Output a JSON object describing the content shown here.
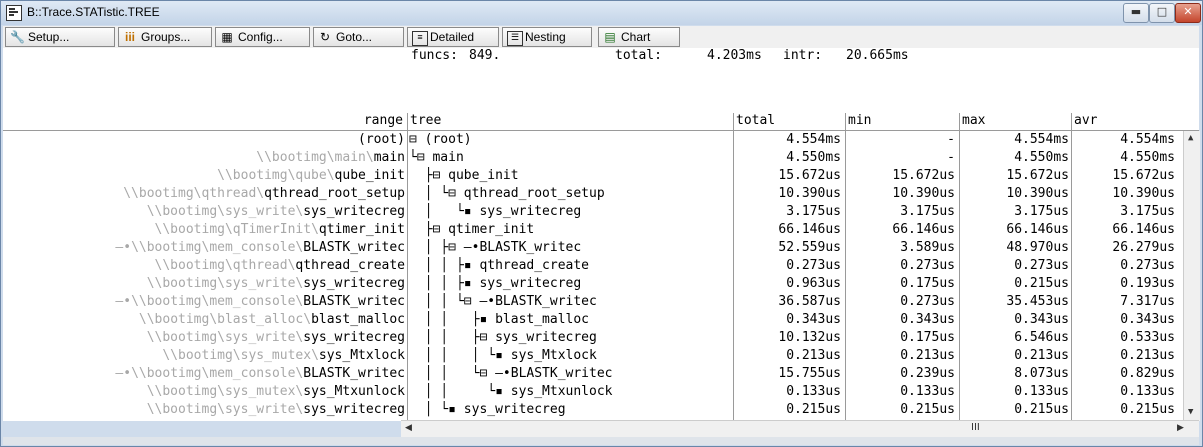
{
  "window": {
    "title": "B::Trace.STATistic.TREE",
    "min_label": "▬",
    "max_label": "□",
    "close_label": "✕"
  },
  "toolbar": {
    "setup": "Setup...",
    "groups": "Groups...",
    "config": "Config...",
    "goto": "Goto...",
    "detailed": "Detailed",
    "nesting": "Nesting",
    "chart": "Chart"
  },
  "stats": {
    "funcs_label": "funcs:",
    "funcs_value": "849.",
    "total_label": "total:",
    "total_value": "4.203ms",
    "intr_label": "intr:",
    "intr_value": "20.665ms"
  },
  "headers": {
    "range": "range",
    "tree": "tree",
    "total": "total",
    "min": "min",
    "max": "max",
    "avr": "avr"
  },
  "rows": [
    {
      "prefix": "",
      "path": "",
      "name": "(root)",
      "tree": "⊟ (root)",
      "total": "4.554ms",
      "min": "-",
      "max": "4.554ms",
      "avr": "4.554ms"
    },
    {
      "prefix": "",
      "path": "\\\\bootimg\\main\\",
      "name": "main",
      "tree": "└⊟ main",
      "total": "4.550ms",
      "min": "-",
      "max": "4.550ms",
      "avr": "4.550ms"
    },
    {
      "prefix": "",
      "path": "\\\\bootimg\\qube\\",
      "name": "qube_init",
      "tree": "  ├⊟ qube_init",
      "total": "15.672us",
      "min": "15.672us",
      "max": "15.672us",
      "avr": "15.672us"
    },
    {
      "prefix": "",
      "path": "\\\\bootimg\\qthread\\",
      "name": "qthread_root_setup",
      "tree": "  │ └⊟ qthread_root_setup",
      "total": "10.390us",
      "min": "10.390us",
      "max": "10.390us",
      "avr": "10.390us"
    },
    {
      "prefix": "",
      "path": "\\\\bootimg\\sys_write\\",
      "name": "sys_writecreg",
      "tree": "  │   └▪ sys_writecreg",
      "total": "3.175us",
      "min": "3.175us",
      "max": "3.175us",
      "avr": "3.175us"
    },
    {
      "prefix": "",
      "path": "\\\\bootimg\\qTimerInit\\",
      "name": "qtimer_init",
      "tree": "  ├⊟ qtimer_init",
      "total": "66.146us",
      "min": "66.146us",
      "max": "66.146us",
      "avr": "66.146us"
    },
    {
      "prefix": "—•",
      "path": "\\\\bootimg\\mem_console\\",
      "name": "BLASTK_writec",
      "tree": "  │ ├⊟ —•BLASTK_writec",
      "total": "52.559us",
      "min": "3.589us",
      "max": "48.970us",
      "avr": "26.279us"
    },
    {
      "prefix": "",
      "path": "\\\\bootimg\\qthread\\",
      "name": "qthread_create",
      "tree": "  │ │ ├▪ qthread_create",
      "total": "0.273us",
      "min": "0.273us",
      "max": "0.273us",
      "avr": "0.273us"
    },
    {
      "prefix": "",
      "path": "\\\\bootimg\\sys_write\\",
      "name": "sys_writecreg",
      "tree": "  │ │ ├▪ sys_writecreg",
      "total": "0.963us",
      "min": "0.175us",
      "max": "0.215us",
      "avr": "0.193us"
    },
    {
      "prefix": "—•",
      "path": "\\\\bootimg\\mem_console\\",
      "name": "BLASTK_writec",
      "tree": "  │ │ └⊟ —•BLASTK_writec",
      "total": "36.587us",
      "min": "0.273us",
      "max": "35.453us",
      "avr": "7.317us"
    },
    {
      "prefix": "",
      "path": "\\\\bootimg\\blast_alloc\\",
      "name": "blast_malloc",
      "tree": "  │ │   ├▪ blast_malloc",
      "total": "0.343us",
      "min": "0.343us",
      "max": "0.343us",
      "avr": "0.343us"
    },
    {
      "prefix": "",
      "path": "\\\\bootimg\\sys_write\\",
      "name": "sys_writecreg",
      "tree": "  │ │   ├⊟ sys_writecreg",
      "total": "10.132us",
      "min": "0.175us",
      "max": "6.546us",
      "avr": "0.533us"
    },
    {
      "prefix": "",
      "path": "\\\\bootimg\\sys_mutex\\",
      "name": "sys_Mtxlock",
      "tree": "  │ │   │ └▪ sys_Mtxlock",
      "total": "0.213us",
      "min": "0.213us",
      "max": "0.213us",
      "avr": "0.213us"
    },
    {
      "prefix": "—•",
      "path": "\\\\bootimg\\mem_console\\",
      "name": "BLASTK_writec",
      "tree": "  │ │   └⊟ —•BLASTK_writec",
      "total": "15.755us",
      "min": "0.239us",
      "max": "8.073us",
      "avr": "0.829us"
    },
    {
      "prefix": "",
      "path": "\\\\bootimg\\sys_mutex\\",
      "name": "sys_Mtxunlock",
      "tree": "  │ │     └▪ sys_Mtxunlock",
      "total": "0.133us",
      "min": "0.133us",
      "max": "0.133us",
      "avr": "0.133us"
    },
    {
      "prefix": "",
      "path": "\\\\bootimg\\sys_write\\",
      "name": "sys_writecreg",
      "tree": "  │ └▪ sys_writecreg",
      "total": "0.215us",
      "min": "0.215us",
      "max": "0.215us",
      "avr": "0.215us"
    }
  ],
  "scroll": {
    "h_thumb_glyph": "III"
  }
}
